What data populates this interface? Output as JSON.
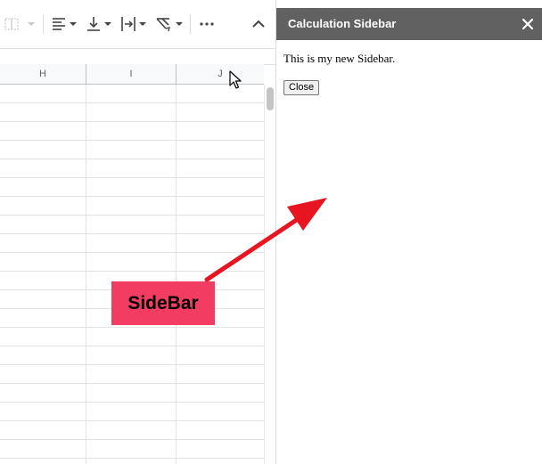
{
  "sheet": {
    "columns": [
      "H",
      "I",
      "J"
    ]
  },
  "sidebar": {
    "title": "Calculation Sidebar",
    "message": "This is my new Sidebar.",
    "close_button_label": "Close"
  },
  "annotation": {
    "label": "SideBar",
    "color": "#f23c62"
  },
  "colors": {
    "sidebar_header_bg": "#616161",
    "arrow": "#e8141f"
  },
  "toolbar": {
    "icons": [
      "merge-cells-icon",
      "horizontal-align-icon",
      "vertical-align-icon",
      "text-wrap-icon",
      "text-rotation-icon",
      "more-icon",
      "collapse-toolbar-icon"
    ]
  }
}
